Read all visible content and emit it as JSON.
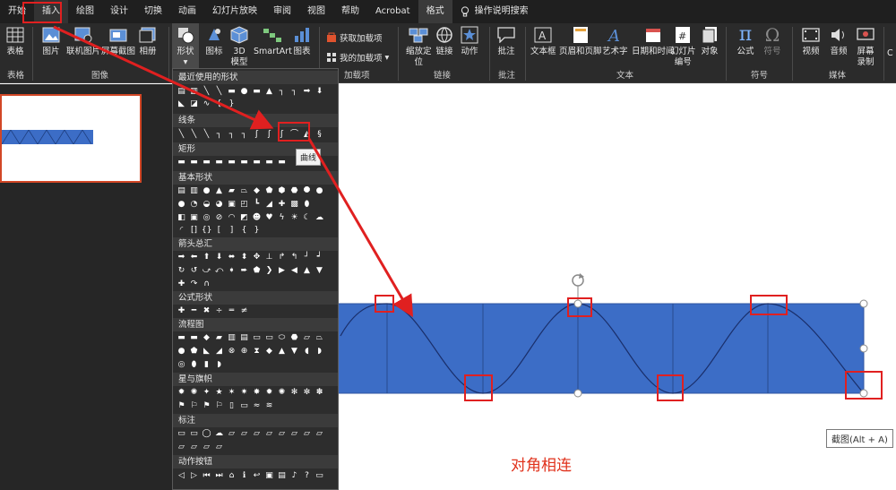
{
  "tabs": [
    {
      "label": "开始"
    },
    {
      "label": "插入"
    },
    {
      "label": "绘图"
    },
    {
      "label": "设计"
    },
    {
      "label": "切换"
    },
    {
      "label": "动画"
    },
    {
      "label": "幻灯片放映"
    },
    {
      "label": "审阅"
    },
    {
      "label": "视图"
    },
    {
      "label": "帮助"
    },
    {
      "label": "Acrobat"
    },
    {
      "label": "格式"
    }
  ],
  "search_label": "操作说明搜索",
  "ribbon": {
    "table": "表格",
    "picture": "图片",
    "online_picture": "联机图片",
    "screenshot": "屏幕截图",
    "album": "相册",
    "shapes": "形状",
    "icons": "图标",
    "model3d_line1": "3D",
    "model3d_line2": "模型",
    "smartart": "SmartArt",
    "chart": "图表",
    "get_addins": "获取加载项",
    "my_addins": "我的加载项",
    "zoom_line1": "缩放定",
    "zoom_line2": "位",
    "link": "链接",
    "action": "动作",
    "comment": "批注",
    "textbox": "文本框",
    "header_footer": "页眉和页脚",
    "wordart": "艺术字",
    "datetime": "日期和时间",
    "slide_num_line1": "幻灯片",
    "slide_num_line2": "编号",
    "object": "对象",
    "equation": "公式",
    "symbol": "符号",
    "video": "视频",
    "audio": "音频",
    "screen_rec_line1": "屏幕",
    "screen_rec_line2": "录制",
    "right_cut": "C"
  },
  "groups": {
    "table": "表格",
    "images": "图像",
    "addins": "加载项",
    "links": "链接",
    "comments": "批注",
    "text": "文本",
    "symbols": "符号",
    "media": "媒体"
  },
  "gallery": {
    "recent": "最近使用的形状",
    "lines": "线条",
    "rectangles": "矩形",
    "basic": "基本形状",
    "arrows": "箭头总汇",
    "equation": "公式形状",
    "flowchart": "流程图",
    "stars": "星与旗帜",
    "callouts": "标注",
    "action_buttons": "动作按钮"
  },
  "tooltip_curve": "曲线",
  "screenshot_tip": "截图(Alt + A)",
  "caption": "对角相连",
  "colors": {
    "annotation_red": "#e02020",
    "shape_fill": "#3c6dc6",
    "caption_red": "#e0321c",
    "thumb_border": "#d24726"
  },
  "icons": {
    "search": "lightbulb-icon"
  }
}
